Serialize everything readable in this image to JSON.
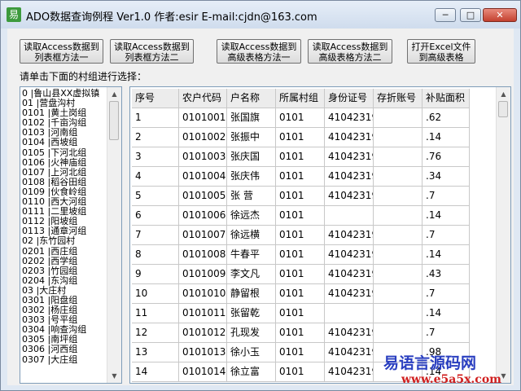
{
  "window": {
    "title": "ADO数据查询例程 Ver1.0 作者:esir E-mail:cjdn@163.com",
    "minimize": "─",
    "maximize": "□",
    "close": "✕"
  },
  "buttons": [
    "读取Access数据到\n列表框方法一",
    "读取Access数据到\n列表框方法二",
    "读取Access数据到\n高级表格方法一",
    "读取Access数据到\n高级表格方法二",
    "打开Excel文件\n到高级表格"
  ],
  "prompt": "请单击下面的村组进行选择：",
  "villages": [
    "0 |鲁山县XX虚拟镇",
    "01 |营盘沟村",
    "0101 |黄土岗组",
    "0102 |千亩沟组",
    "0103 |河南组",
    "0104 |西坡组",
    "0105 |下河北组",
    "0106 |火神庙组",
    "0107 |上河北组",
    "0108 |稻谷田组",
    "0109 |伙食岭组",
    "0110 |西大河组",
    "0111 |二里坡组",
    "0112 |阳坡组",
    "0113 |通章河组",
    "02 |东竹园村",
    "0201 |西庄组",
    "0202 |西学组",
    "0203 |竹园组",
    "0204 |东沟组",
    "03 |大庄村",
    "0301 |阳盘组",
    "0302 |杨庄组",
    "0303 |号平组",
    "0304 |响查沟组",
    "0305 |南坪组",
    "0306 |河西组",
    "0307 |大庄组"
  ],
  "table": {
    "headers": [
      "序号",
      "农户代码",
      "户名称",
      "所属村组",
      "身份证号",
      "存折账号",
      "补贴面积"
    ],
    "rows": [
      [
        "1",
        "0101001",
        "张国旗",
        "0101",
        "41042319",
        "",
        ".62"
      ],
      [
        "2",
        "0101002",
        "张振中",
        "0101",
        "41042319",
        "",
        ".14"
      ],
      [
        "3",
        "0101003",
        "张庆国",
        "0101",
        "41042319",
        "",
        ".76"
      ],
      [
        "4",
        "0101004",
        "张庆伟",
        "0101",
        "41042319",
        "",
        ".34"
      ],
      [
        "5",
        "0101005",
        "张 营",
        "0101",
        "41042319",
        "",
        ".7"
      ],
      [
        "6",
        "0101006",
        "徐远杰",
        "0101",
        "",
        "",
        ".14"
      ],
      [
        "7",
        "0101007",
        "徐远横",
        "0101",
        "41042319",
        "",
        ".7"
      ],
      [
        "8",
        "0101008",
        "牛春平",
        "0101",
        "41042319",
        "",
        ".14"
      ],
      [
        "9",
        "0101009",
        "李文凡",
        "0101",
        "41042319",
        "",
        ".43"
      ],
      [
        "10",
        "0101010",
        "静留根",
        "0101",
        "41042319",
        "",
        ".7"
      ],
      [
        "11",
        "0101011",
        "张留乾",
        "0101",
        "",
        "",
        ".14"
      ],
      [
        "12",
        "0101012",
        "孔现发",
        "0101",
        "41042319",
        "",
        ".7"
      ],
      [
        "13",
        "0101013",
        "徐小玉",
        "0101",
        "41042319",
        "",
        ".98"
      ],
      [
        "14",
        "0101014",
        "徐立富",
        "0101",
        "41042319",
        "",
        ".14"
      ]
    ]
  },
  "watermark": {
    "line1": "易语言源码网",
    "line2": "www.e5a5x.com"
  }
}
